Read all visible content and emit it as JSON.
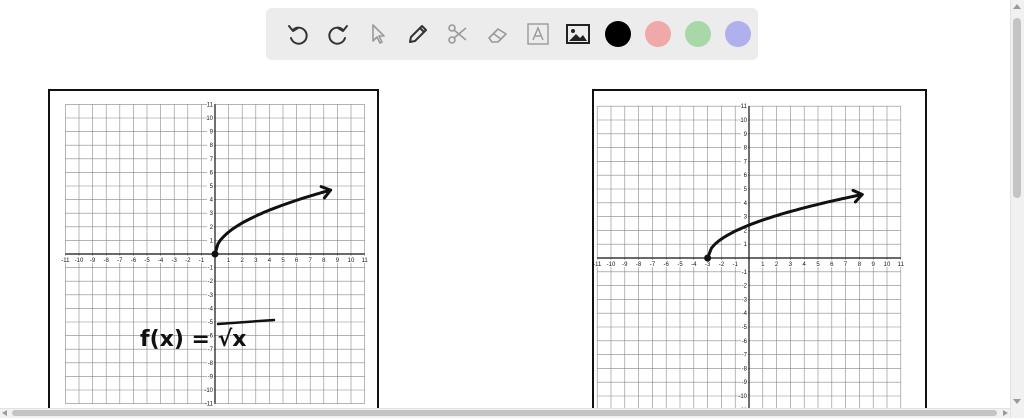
{
  "toolbar": {
    "tools": [
      {
        "name": "undo-icon"
      },
      {
        "name": "redo-icon"
      },
      {
        "name": "select-cursor-icon"
      },
      {
        "name": "pen-icon"
      },
      {
        "name": "scissors-icon"
      },
      {
        "name": "eraser-icon"
      },
      {
        "name": "text-tool-icon"
      },
      {
        "name": "image-icon"
      }
    ],
    "colors": [
      "#000000",
      "#f0a8a8",
      "#a8d8a8",
      "#b0b0ee"
    ]
  },
  "graph_a": {
    "x_ticks": [
      "-11",
      "-10",
      "-9",
      "-8",
      "-7",
      "-6",
      "-5",
      "-4",
      "-3",
      "-2",
      "-1",
      "1",
      "2",
      "3",
      "4",
      "5",
      "6",
      "7",
      "8",
      "9",
      "10",
      "11"
    ],
    "y_ticks": [
      "11",
      "10",
      "9",
      "8",
      "7",
      "6",
      "5",
      "4",
      "3",
      "2",
      "1",
      "-1",
      "-2",
      "-3",
      "-4",
      "-5",
      "-6",
      "-7",
      "-8",
      "-9",
      "-10",
      "-11"
    ],
    "formula": "f(x) = √x",
    "curve_start": [
      0,
      0
    ],
    "curve_end": [
      8.5,
      4.7
    ]
  },
  "graph_b": {
    "x_ticks": [
      "-11",
      "-10",
      "-9",
      "-8",
      "-7",
      "-6",
      "-5",
      "-4",
      "-3",
      "-2",
      "-1",
      "1",
      "2",
      "3",
      "4",
      "5",
      "6",
      "7",
      "8",
      "9",
      "10",
      "11"
    ],
    "y_ticks": [
      "11",
      "10",
      "9",
      "8",
      "7",
      "6",
      "5",
      "4",
      "3",
      "2",
      "1",
      "-1",
      "-2",
      "-3",
      "-4",
      "-5",
      "-6",
      "-7",
      "-8",
      "-9",
      "-10",
      "-11"
    ],
    "curve_start": [
      -3,
      0
    ],
    "curve_end": [
      8.2,
      4.6
    ]
  }
}
